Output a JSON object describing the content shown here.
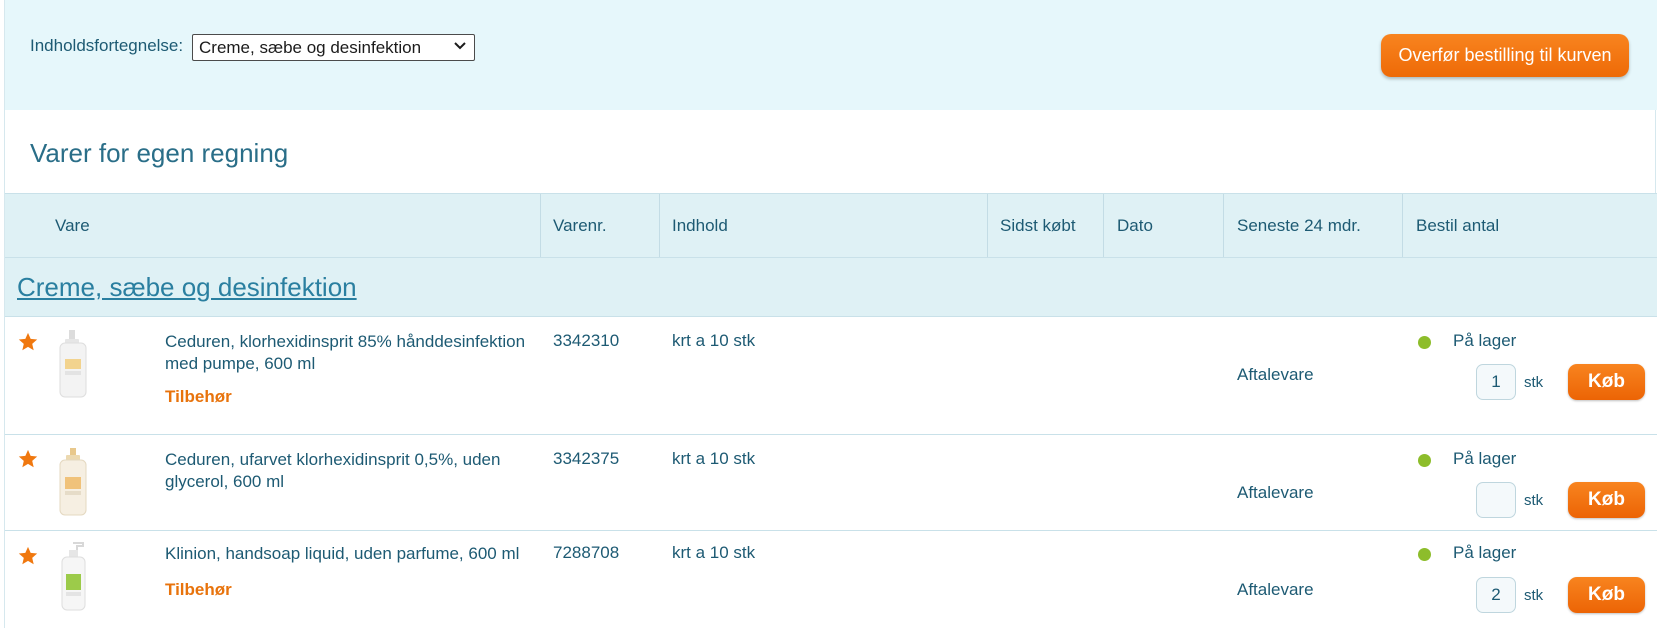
{
  "toolbar": {
    "toc_label": "Indholdsfortegnelse:",
    "toc_selected": "Creme, sæbe og desinfektion",
    "transfer_label": "Overfør bestilling til kurven"
  },
  "section": {
    "title": "Varer for egen regning"
  },
  "table": {
    "columns": [
      "Vare",
      "Varenr.",
      "Indhold",
      "Sidst købt",
      "Dato",
      "Seneste 24 mdr.",
      "Bestil antal"
    ]
  },
  "category": {
    "title": "Creme, sæbe og desinfektion"
  },
  "products": [
    {
      "name": "Ceduren, klorhexidinsprit 85% hånddesinfektion med pumpe, 600 ml",
      "accessory": "Tilbehør",
      "varenr": "3342310",
      "indhold": "krt a 10 stk",
      "agreement": "Aftalevare",
      "stock": "På lager",
      "quantity": "1",
      "unit": "stk",
      "buy_label": "Køb"
    },
    {
      "name": "Ceduren, ufarvet klorhexidinsprit 0,5%, uden glycerol, 600 ml",
      "accessory": "",
      "varenr": "3342375",
      "indhold": "krt a 10 stk",
      "agreement": "Aftalevare",
      "stock": "På lager",
      "quantity": "",
      "unit": "stk",
      "buy_label": "Køb"
    },
    {
      "name": "Klinion, handsoap liquid, uden parfume, 600 ml",
      "accessory": "Tilbehør",
      "varenr": "7288708",
      "indhold": "krt a 10 stk",
      "agreement": "Aftalevare",
      "stock": "På lager",
      "quantity": "2",
      "unit": "stk",
      "buy_label": "Køb"
    }
  ],
  "colors": {
    "accent_orange": "#ee6a07",
    "header_bg": "#dff1f5",
    "topbar_bg": "#e6f7fb",
    "text": "#1d5a73",
    "stock_green": "#8dbd2b",
    "star_orange": "#f0780f"
  },
  "icons": [
    "favorite-star-icon",
    "product-bottle-icon",
    "chevron-down-icon",
    "stock-status-dot-icon"
  ]
}
